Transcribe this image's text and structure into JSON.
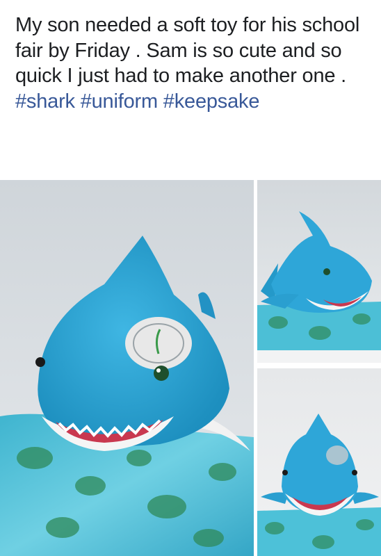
{
  "post": {
    "text_parts": [
      {
        "type": "text",
        "value": "My son needed a soft toy for his school  fair by Friday . Sam is so cute and so quick I just had to make another one . "
      },
      {
        "type": "hashtag",
        "value": "#shark"
      },
      {
        "type": "text",
        "value": " "
      },
      {
        "type": "hashtag",
        "value": "#uniform"
      },
      {
        "type": "text",
        "value": " "
      },
      {
        "type": "hashtag",
        "value": "#keepsake"
      }
    ]
  },
  "colors": {
    "hashtag": "#385898",
    "text": "#1c1e21",
    "shark": "#2fa4d4",
    "fabric": "#4fc0d8"
  },
  "photos": [
    {
      "name": "shark-plush-side-view",
      "icon": "shark-plush-image"
    },
    {
      "name": "shark-plush-angle-view",
      "icon": "shark-plush-image"
    },
    {
      "name": "shark-plush-front-view",
      "icon": "shark-plush-image"
    }
  ]
}
